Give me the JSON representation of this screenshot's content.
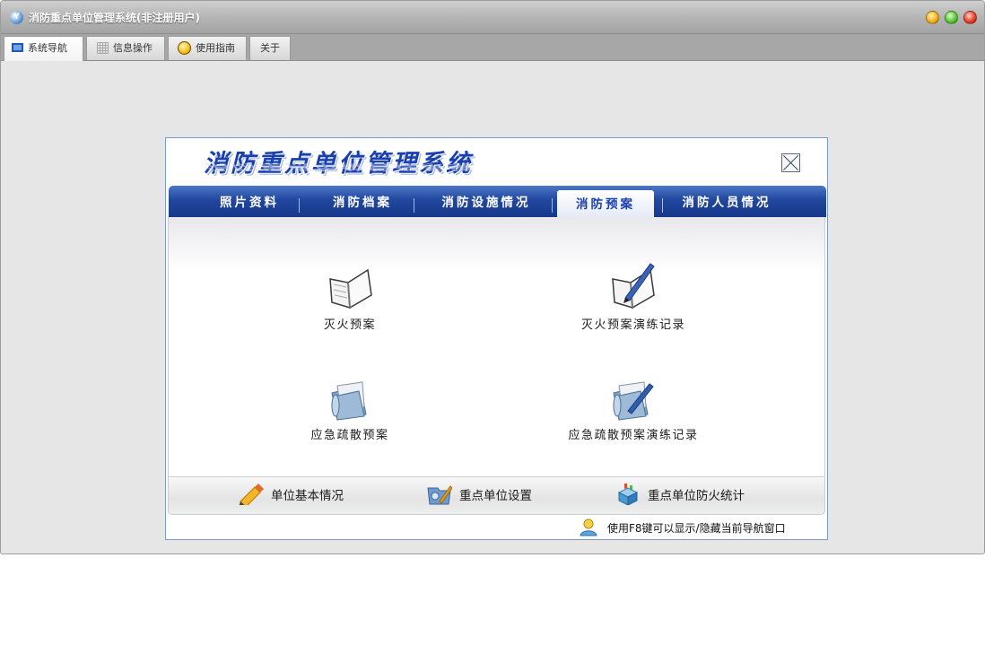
{
  "window": {
    "title": "消防重点单位管理系统(非注册用户)",
    "app_icon_glyph": "Y"
  },
  "top_tabs": [
    {
      "label": "系统导航",
      "icon": "monitor-icon"
    },
    {
      "label": "信息操作",
      "icon": "grid-icon"
    },
    {
      "label": "使用指南",
      "icon": "info-ball-icon"
    },
    {
      "label": "关于",
      "icon": ""
    }
  ],
  "panel": {
    "brand": "消防重点单位管理系统",
    "tabs": [
      "照片资料",
      "消防档案",
      "消防设施情况",
      "消防预案",
      "消防人员情况"
    ],
    "active_tab": "消防预案",
    "items": [
      {
        "label": "灭火预案",
        "icon": "open-book-icon"
      },
      {
        "label": "灭火预案演练记录",
        "icon": "book-with-pen-icon"
      },
      {
        "label": "应急疏散预案",
        "icon": "scroll-folder-icon"
      },
      {
        "label": "应急疏散预案演练记录",
        "icon": "scroll-folder-pen-icon"
      }
    ],
    "bottom": [
      {
        "label": "单位基本情况",
        "icon": "pencil-icon"
      },
      {
        "label": "重点单位设置",
        "icon": "folder-tools-icon"
      },
      {
        "label": "重点单位防火统计",
        "icon": "chart-cube-icon"
      }
    ],
    "hint": "使用F8键可以显示/隐藏当前导航窗口"
  },
  "colors": {
    "tab_blue": "#21479e",
    "brand_blue": "#1a3fae"
  }
}
